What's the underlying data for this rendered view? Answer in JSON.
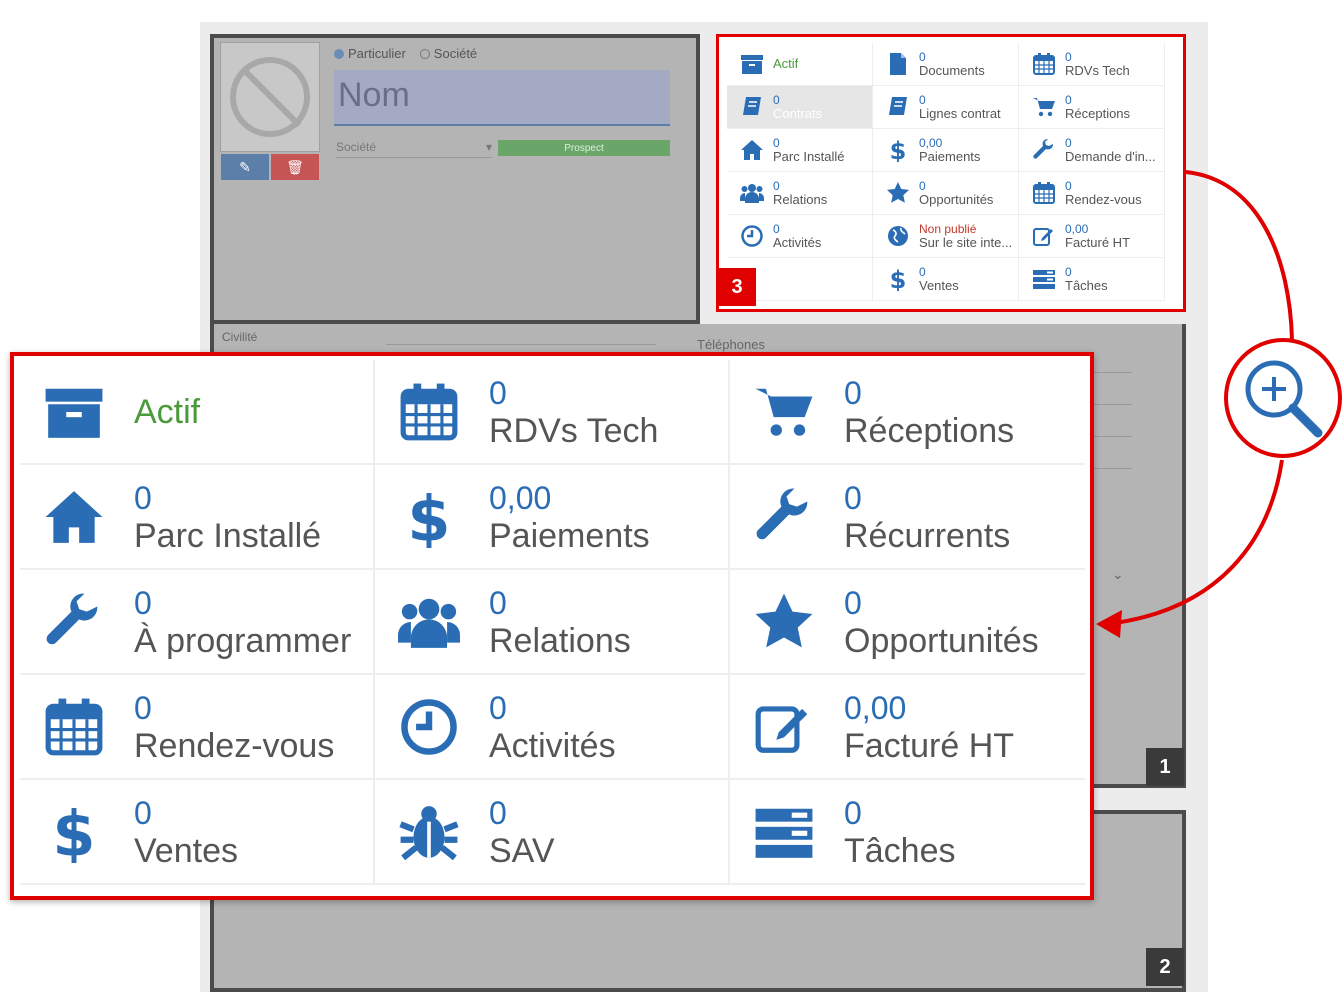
{
  "left_form": {
    "radio_particulier": "Particulier",
    "radio_societe": "Société",
    "nom_placeholder": "Nom",
    "societe_label": "Société",
    "prospect_label": "Prospect",
    "civilite_label": "Civilité",
    "telephones_label": "Téléphones"
  },
  "badges": {
    "one": "1",
    "two": "2",
    "three": "3"
  },
  "small_panel": {
    "cells": [
      {
        "num": "",
        "label": "Actif",
        "icon": "archive-icon"
      },
      {
        "num": "0",
        "label": "Documents",
        "icon": "document-icon"
      },
      {
        "num": "0",
        "label": "RDVs Tech",
        "icon": "calendar-icon"
      },
      {
        "num": "0",
        "label": "Contrats",
        "icon": "book-icon"
      },
      {
        "num": "0",
        "label": "Lignes contrat",
        "icon": "book-icon"
      },
      {
        "num": "0",
        "label": "Réceptions",
        "icon": "cart-icon"
      },
      {
        "num": "0",
        "label": "Parc Installé",
        "icon": "home-icon"
      },
      {
        "num": "0,00",
        "label": "Paiements",
        "icon": "dollar-icon"
      },
      {
        "num": "0",
        "label": "Demande d'in...",
        "icon": "wrench-icon"
      },
      {
        "num": "0",
        "label": "Relations",
        "icon": "users-icon"
      },
      {
        "num": "0",
        "label": "Opportunités",
        "icon": "star-icon"
      },
      {
        "num": "0",
        "label": "Rendez-vous",
        "icon": "calendar-icon"
      },
      {
        "num": "0",
        "label": "Activités",
        "icon": "clock-icon"
      },
      {
        "num": "Non publié",
        "label": "Sur le site inte...",
        "icon": "globe-icon"
      },
      {
        "num": "0,00",
        "label": "Facturé HT",
        "icon": "edit-icon"
      },
      {
        "num": "",
        "label": "",
        "icon": ""
      },
      {
        "num": "0",
        "label": "Ventes",
        "icon": "dollar-icon"
      },
      {
        "num": "0",
        "label": "Tâches",
        "icon": "tasks-icon"
      }
    ]
  },
  "zoom_panel": {
    "cells": [
      {
        "num": "",
        "label": "Actif",
        "icon": "archive-icon"
      },
      {
        "num": "0",
        "label": "RDVs Tech",
        "icon": "calendar-icon"
      },
      {
        "num": "0",
        "label": "Réceptions",
        "icon": "cart-icon"
      },
      {
        "num": "0",
        "label": "Parc Installé",
        "icon": "home-icon"
      },
      {
        "num": "0,00",
        "label": "Paiements",
        "icon": "dollar-icon"
      },
      {
        "num": "0",
        "label": "Récurrents",
        "icon": "wrench-icon"
      },
      {
        "num": "0",
        "label": "À programmer",
        "icon": "wrench-icon"
      },
      {
        "num": "0",
        "label": "Relations",
        "icon": "users-icon"
      },
      {
        "num": "0",
        "label": "Opportunités",
        "icon": "star-icon"
      },
      {
        "num": "0",
        "label": "Rendez-vous",
        "icon": "calendar-icon"
      },
      {
        "num": "0",
        "label": "Activités",
        "icon": "clock-icon"
      },
      {
        "num": "0,00",
        "label": "Facturé HT",
        "icon": "edit-icon"
      },
      {
        "num": "0",
        "label": "Ventes",
        "icon": "dollar-icon"
      },
      {
        "num": "0",
        "label": "SAV",
        "icon": "bug-icon"
      },
      {
        "num": "0",
        "label": "Tâches",
        "icon": "tasks-icon"
      }
    ]
  },
  "colors": {
    "accent_blue": "#2a6db5",
    "highlight_red": "#e00000",
    "active_green": "#4a9a3a"
  }
}
